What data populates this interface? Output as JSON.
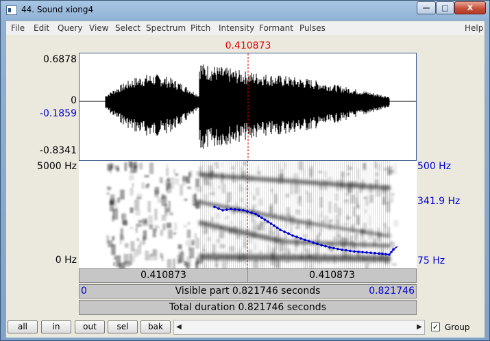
{
  "window": {
    "title": "44. Sound xiong4",
    "min_glyph": "—",
    "max_glyph": "□",
    "close_glyph": "X"
  },
  "menu": {
    "items": [
      "File",
      "Edit",
      "Query",
      "View",
      "Select",
      "Spectrum",
      "Pitch",
      "Intensity",
      "Formant",
      "Pulses"
    ],
    "help": "Help"
  },
  "cursor": {
    "time": "0.410873"
  },
  "waveform": {
    "max": "0.6878",
    "zero": "0",
    "cursor_value": "-0.1859",
    "min": "-0.8341"
  },
  "spectrogram": {
    "freq_top": "5000 Hz",
    "freq_bottom": "0 Hz",
    "pitch_top": "500 Hz",
    "pitch_mid": "341.9 Hz",
    "pitch_bottom": "75 Hz"
  },
  "time_bar": {
    "left": "0.410873",
    "right": "0.410873"
  },
  "visible": {
    "start": "0",
    "label": "Visible part 0.821746 seconds",
    "end": "0.821746"
  },
  "total": {
    "label": "Total duration 0.821746 seconds"
  },
  "bottom": {
    "buttons": [
      "all",
      "in",
      "out",
      "sel",
      "bak"
    ],
    "group_label": "Group",
    "group_checked": "✓",
    "scroll_left": "◀",
    "scroll_right": "▶"
  },
  "colors": {
    "cursor": "#e00000",
    "pitch": "#0000d0",
    "axis_blue": "#0000d0"
  },
  "chart_data": {
    "type": "line",
    "x_unit": "seconds",
    "y_unit": "Hz",
    "xlim": [
      0,
      0.821746
    ],
    "ylim": [
      75,
      500
    ],
    "pitch_track": {
      "x": [
        0.33,
        0.35,
        0.37,
        0.4,
        0.43,
        0.46,
        0.49,
        0.52,
        0.55,
        0.58,
        0.61,
        0.64,
        0.67,
        0.7,
        0.73,
        0.755,
        0.765,
        0.775
      ],
      "y": [
        318,
        305,
        310,
        305,
        290,
        260,
        228,
        205,
        188,
        172,
        158,
        149,
        142,
        138,
        134,
        130,
        150,
        162
      ]
    }
  }
}
